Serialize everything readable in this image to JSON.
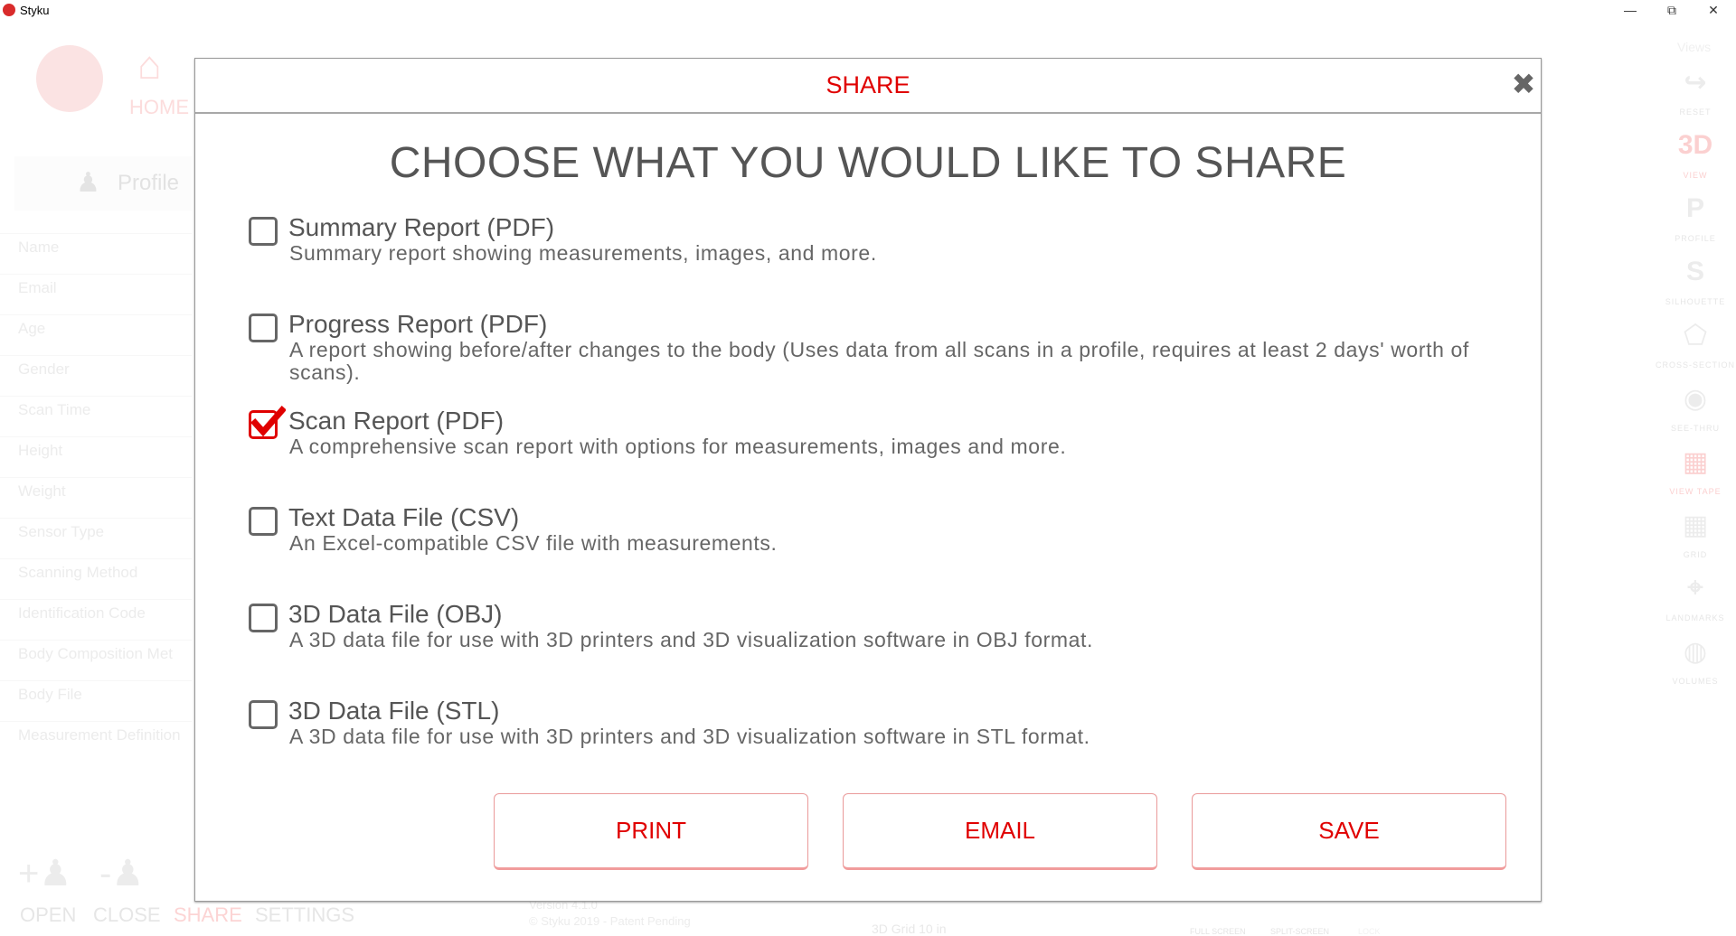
{
  "window": {
    "title": "Styku",
    "minimize_icon": "minimize-icon",
    "restore_icon": "restore-icon",
    "close_icon": "close-icon"
  },
  "background": {
    "home_label": "HOME",
    "profile_label": "Profile",
    "profile_fields": [
      "Name",
      "Email",
      "Age",
      "Gender",
      "Scan Time",
      "Height",
      "Weight",
      "Sensor Type",
      "Scanning Method",
      "Identification Code",
      "Body Composition Met",
      "Body File",
      "Measurement Definition"
    ],
    "bottom_nav": [
      "OPEN",
      "CLOSE",
      "SHARE",
      "SETTINGS"
    ],
    "version": "Version 4.1.0",
    "copyright": "© Styku 2019 - Patent Pending",
    "grid_label": "3D Grid 10 in",
    "bottom_tools": [
      "FULL SCREEN",
      "SPLIT-SCREEN",
      "LOCK"
    ],
    "views_title": "Views",
    "views": [
      {
        "icon": "↪",
        "label": "RESET"
      },
      {
        "icon": "3D",
        "label": "VIEW"
      },
      {
        "icon": "P",
        "label": "PROFILE"
      },
      {
        "icon": "S",
        "label": "SILHOUETTE"
      },
      {
        "icon": "⬠",
        "label": "CROSS-SECTION"
      },
      {
        "icon": "◉",
        "label": "SEE-THRU"
      },
      {
        "icon": "▦",
        "label": "VIEW TAPE"
      },
      {
        "icon": "▦",
        "label": "GRID"
      },
      {
        "icon": "⌖",
        "label": "LANDMARKS"
      },
      {
        "icon": "◍",
        "label": "VOLUMES"
      }
    ]
  },
  "dialog": {
    "title": "SHARE",
    "heading": "CHOOSE WHAT YOU WOULD LIKE TO SHARE",
    "accent_color": "#e00000",
    "options": [
      {
        "title": "Summary Report (PDF)",
        "description": "Summary report showing measurements, images, and more.",
        "checked": false
      },
      {
        "title": "Progress Report (PDF)",
        "description": "A report showing before/after changes to the body (Uses data from all scans in a profile, requires at least 2 days' worth of scans).",
        "checked": false
      },
      {
        "title": "Scan Report (PDF)",
        "description": "A comprehensive scan report with options for measurements, images and more.",
        "checked": true
      },
      {
        "title": "Text Data File (CSV)",
        "description": "An Excel-compatible CSV file with measurements.",
        "checked": false
      },
      {
        "title": "3D Data File (OBJ)",
        "description": "A 3D data file for use with 3D printers and 3D visualization software in OBJ format.",
        "checked": false
      },
      {
        "title": "3D Data File (STL)",
        "description": "A 3D data file for use with 3D printers and 3D visualization software in STL format.",
        "checked": false
      }
    ],
    "buttons": {
      "print": "PRINT",
      "email": "EMAIL",
      "save": "SAVE"
    }
  }
}
